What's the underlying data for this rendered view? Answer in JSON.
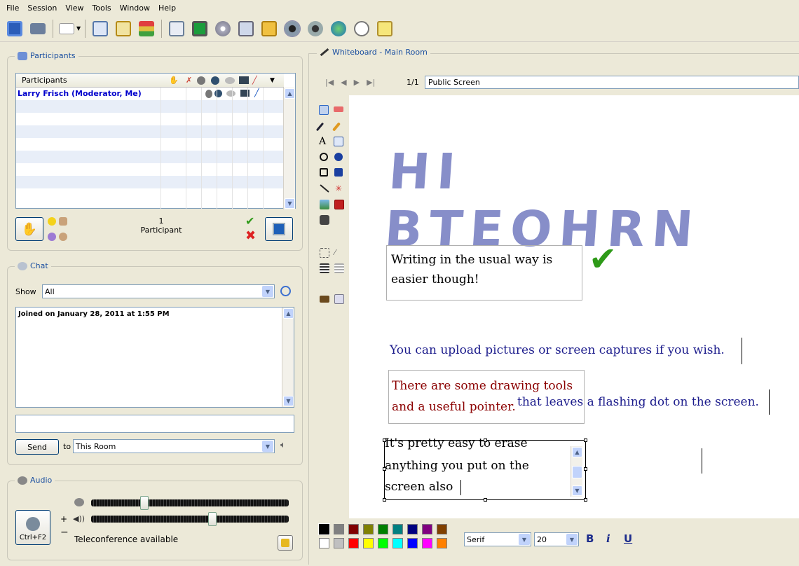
{
  "menu": [
    "File",
    "Session",
    "View",
    "Tools",
    "Window",
    "Help"
  ],
  "toolbar_icons": [
    "save-icon",
    "print-icon",
    "layout-icon",
    "chevron-down-icon",
    "document-icon",
    "document-lock-icon",
    "document-stack-icon",
    "projector-icon",
    "monitor-icon",
    "disc-icon",
    "document-settings-icon",
    "folder-arrow-icon",
    "webcam-icon",
    "webcam-user-icon",
    "globe-icon",
    "timer-icon",
    "notepad-icon"
  ],
  "participants": {
    "title": "Participants",
    "header": "Participants",
    "rows": [
      {
        "name": "Larry Frisch (Moderator, Me)"
      }
    ],
    "count": "1",
    "count_label": "Participant"
  },
  "chat": {
    "title": "Chat",
    "show_label": "Show",
    "show_value": "All",
    "log": "Joined on January 28, 2011 at 1:55 PM",
    "input": "",
    "send_label": "Send",
    "to_label": "to",
    "to_value": "This Room"
  },
  "audio": {
    "title": "Audio",
    "mic_button_label": "Ctrl+F2",
    "plus": "+",
    "minus": "−",
    "status": "Teleconference available",
    "mic_level": 0.26,
    "speaker_level": 0.62
  },
  "whiteboard": {
    "title": "Whiteboard - Main Room",
    "page": "1/1",
    "screen_name": "Public Screen",
    "handwriting": "HI BTEOHRN",
    "box1": [
      "Writing in the usual way is",
      "easier though!"
    ],
    "upload_text": "You can upload pictures or screen captures if you wish.",
    "red_text": [
      "There are some drawing tools",
      "and a useful pointer."
    ],
    "blue_text2": "that leaves a flashing dot on the screen.",
    "erase_text": [
      "It's pretty easy to erase",
      "anything you put on the",
      "screen also"
    ]
  },
  "format": {
    "font": "Serif",
    "size": "20",
    "bold": "B",
    "italic": "i",
    "underline": "U"
  },
  "colors": {
    "accent": "#1a4fa0",
    "participant_name": "#0000cc",
    "red_text": "#8b0000",
    "blue_text": "#1c1c8c",
    "handwriting": "#7b82c4",
    "check": "#2e9a18"
  },
  "palette_row1": [
    "#000000",
    "#808080",
    "#800000",
    "#808000",
    "#008000",
    "#008080",
    "#000080",
    "#800080",
    "#804000"
  ],
  "palette_row2": [
    "#ffffff",
    "#c0c0c0",
    "#ff0000",
    "#ffff00",
    "#00ff00",
    "#00ffff",
    "#0000ff",
    "#ff00ff",
    "#ff8000"
  ]
}
